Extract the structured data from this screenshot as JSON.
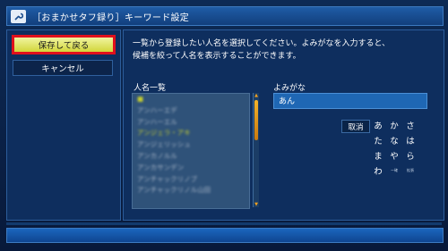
{
  "header": {
    "title": "［おまかせタフ録り］キーワード設定",
    "icon": "wrench-icon"
  },
  "left_panel": {
    "save_label": "保存して戻る",
    "cancel_label": "キャンセル"
  },
  "right_panel": {
    "instruction_line1": "一覧から登録したい人名を選択してください。よみがなを入力すると、",
    "instruction_line2": "候補を絞って人名を表示することができます。",
    "list_label": "人名一覧",
    "yomi_label": "よみがな",
    "yomi_value": "あん",
    "list_items": [
      "■",
      "アンハーエデ",
      "アンハーエル",
      "アンジェラ・アキ",
      "アンジェリッシュ",
      "アンカノルル",
      "アンカサンデン",
      "アンチャックリノブ",
      "アンチャックリノル山田"
    ],
    "clear_label": "取消",
    "kana_keys": [
      "あ",
      "か",
      "さ",
      "た",
      "な",
      "は",
      "ま",
      "や",
      "ら",
      "わ"
    ],
    "small_keys": [
      "ー確",
      "拡張"
    ]
  },
  "colors": {
    "accent_yellow": "#d2d63a",
    "focus_red": "#e0101c",
    "scroll_orange": "#f4b32a",
    "panel_blue": "#0e2e5e"
  }
}
